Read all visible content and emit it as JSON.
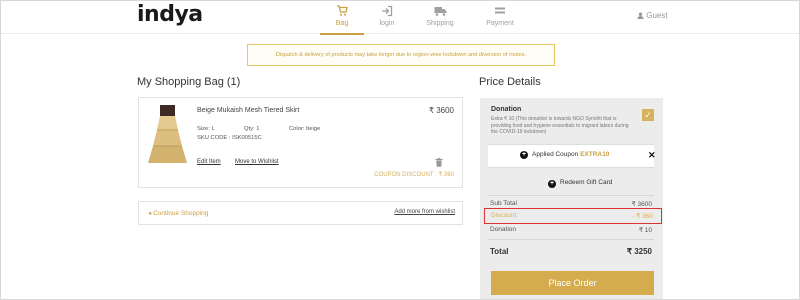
{
  "brand": {
    "logo_text": "indya"
  },
  "nav": {
    "steps": [
      {
        "label": "Bag",
        "icon": "cart-icon",
        "active": true
      },
      {
        "label": "login",
        "icon": "login-icon",
        "active": false
      },
      {
        "label": "Shipping",
        "icon": "truck-icon",
        "active": false
      },
      {
        "label": "Payment",
        "icon": "payment-icon",
        "active": false
      }
    ],
    "guest_label": "Guest"
  },
  "notice": "Dispatch & delivery of products may take longer due to region-wise lockdown and diversion of routes.",
  "bag": {
    "title": "My Shopping Bag (1)",
    "item": {
      "name": "Beige Mukaish Mesh Tiered Skirt",
      "price": "₹ 3600",
      "size": "Size: L",
      "qty": "Qty: 1",
      "color": "Color: beige",
      "sku": "SKU CODE : ISK00515C",
      "edit_label": "Edit Item",
      "wishlist_label": "Move to Wishlist",
      "coupon_discount": "COUPON DISCOUNT : ₹ 360"
    },
    "continue_label": "Continue Shopping",
    "add_from_wishlist_label": "Add more from wishlist"
  },
  "price": {
    "title": "Price Details",
    "donation_label": "Donation",
    "donation_desc": "Extra ₹ 10 (This donation is towards NGO Syrishti that is providing food and hygiene essentials to migrant labors during the COVID-19 lockdown)",
    "donation_checked": true,
    "coupon_prefix": "Applied Coupon",
    "coupon_code": "EXTRA10",
    "gift_card_label": "Redeem Gift Card",
    "subtotal_label": "Sub Total",
    "subtotal_value": "₹ 3600",
    "discount_label": "Discount",
    "discount_value": "- ₹ 360",
    "donation_row_label": "Donation",
    "donation_row_value": "₹ 10",
    "total_label": "Total",
    "total_value": "₹ 3250",
    "place_order_label": "Place Order"
  },
  "colors": {
    "accent": "#c8a040",
    "button": "#d4ac4e",
    "highlight_border": "#dd3333"
  }
}
